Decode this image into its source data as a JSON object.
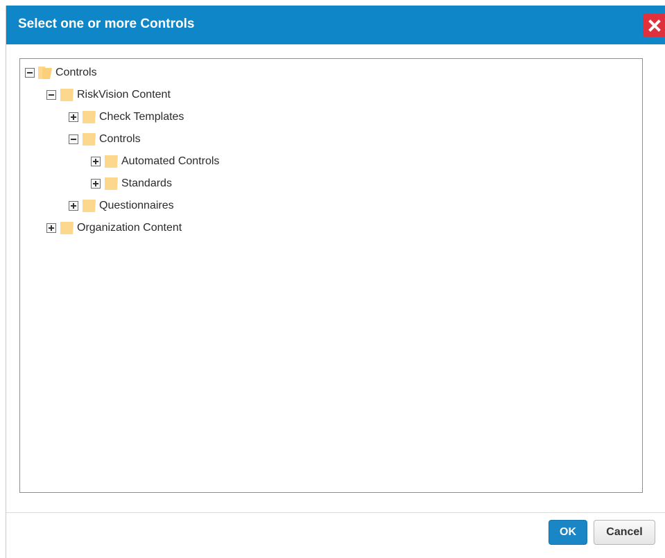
{
  "dialog": {
    "title": "Select one or more Controls",
    "close_icon": "close-icon"
  },
  "tree": {
    "nodes": [
      {
        "label": "Controls",
        "state": "expanded",
        "icon": "folder-icon"
      },
      {
        "label": "RiskVision Content",
        "state": "expanded",
        "icon": "folder-icon"
      },
      {
        "label": "Check Templates",
        "state": "collapsed",
        "icon": "folder-icon"
      },
      {
        "label": "Controls",
        "state": "expanded",
        "icon": "folder-icon"
      },
      {
        "label": "Automated Controls",
        "state": "collapsed",
        "icon": "folder-icon"
      },
      {
        "label": "Standards",
        "state": "collapsed",
        "icon": "folder-icon"
      },
      {
        "label": "Questionnaires",
        "state": "collapsed",
        "icon": "folder-icon"
      },
      {
        "label": "Organization Content",
        "state": "collapsed",
        "icon": "folder-icon"
      }
    ]
  },
  "footer": {
    "ok_label": "OK",
    "cancel_label": "Cancel"
  },
  "colors": {
    "titlebar": "#0e86c8",
    "close": "#e0303c",
    "folder": "#fdd88c",
    "ok_button": "#1b86c6"
  }
}
